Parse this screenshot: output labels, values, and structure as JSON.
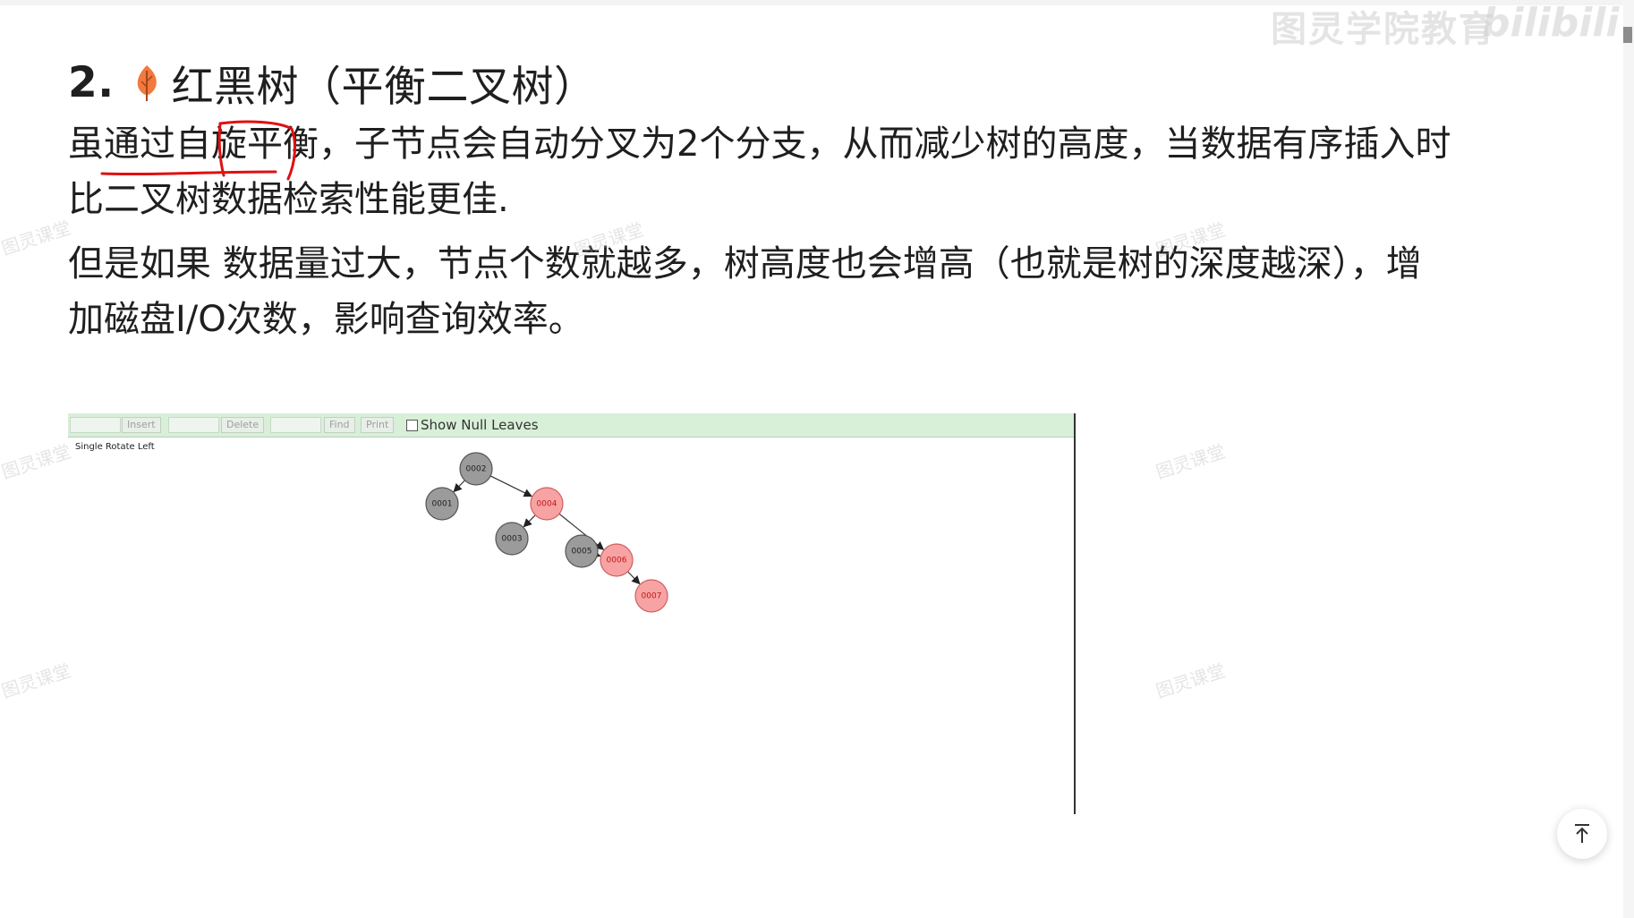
{
  "heading": {
    "number": "2.",
    "icon": "leaf-icon",
    "title": "红黑树（平衡二叉树）"
  },
  "paragraphs": {
    "p1_line1": "虽通过自旋平衡，子节点会自动分叉为2个分支，从而减少树的高度，当数据有序插入时",
    "p1_line2": "比二叉树数据检索性能更佳.",
    "p2_line1": "但是如果 数据量过大，节点个数就越多，树高度也会增高（也就是树的深度越深），增",
    "p2_line2": "加磁盘I/O次数，影响查询效率。"
  },
  "demo": {
    "toolbar": {
      "insert_label": "Insert",
      "delete_label": "Delete",
      "find_label": "Find",
      "print_label": "Print",
      "show_null_leaves_label": "Show Null Leaves"
    },
    "status_text": "Single Rotate Left",
    "tree": {
      "nodes": [
        {
          "id": "0002",
          "color": "black"
        },
        {
          "id": "0001",
          "color": "black"
        },
        {
          "id": "0004",
          "color": "red"
        },
        {
          "id": "0003",
          "color": "black"
        },
        {
          "id": "0005",
          "color": "black"
        },
        {
          "id": "0006",
          "color": "red"
        },
        {
          "id": "0007",
          "color": "red"
        }
      ],
      "edges": [
        [
          "0002",
          "0001"
        ],
        [
          "0002",
          "0004"
        ],
        [
          "0004",
          "0003"
        ],
        [
          "0004",
          "0006"
        ],
        [
          "0005",
          "0006"
        ],
        [
          "0006",
          "0007"
        ]
      ]
    }
  },
  "colors": {
    "black_node": "#9b9b9b",
    "red_node": "#f7a3a3",
    "ink": "#e01010",
    "toolbar_bg": "#d8efd8"
  },
  "watermarks": {
    "course": "图灵课堂",
    "brand": "图灵学院教育",
    "bilibili": "bilibili"
  },
  "back_to_top_icon": "arrow-up-to-line-icon"
}
